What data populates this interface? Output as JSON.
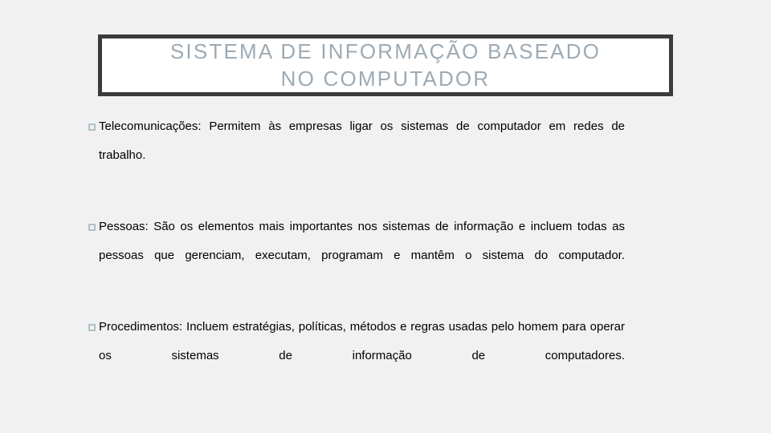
{
  "slide": {
    "background_color": "#f1f1f1",
    "title": {
      "line1": "SISTEMA DE INFORMAÇÃO BASEADO",
      "line2": "NO COMPUTADOR",
      "full_text": "SISTEMA DE INFORMAÇÃO BASEADO\nNO COMPUTADOR",
      "text_color": "#9daab4",
      "box_fill": "#ffffff",
      "box_border_color": "#3b3b3b"
    },
    "bullets": [
      {
        "marker": "hollow-square-bullet",
        "term": "Telecomunicações:",
        "text": "Telecomunicações: Permitem às empresas ligar os sistemas de computador em redes de trabalho."
      },
      {
        "marker": "hollow-square-bullet",
        "term": "Pessoas:",
        "text": "Pessoas: São os elementos mais importantes nos sistemas de informação e incluem todas as pessoas que gerenciam, executam, programam e mantêm o sistema do computador."
      },
      {
        "marker": "hollow-square-bullet",
        "term": "Procedimentos:",
        "text": "Procedimentos: Incluem estratégias, políticas, métodos e regras usadas pelo homem para operar os sistemas de informação de computadores."
      }
    ]
  }
}
